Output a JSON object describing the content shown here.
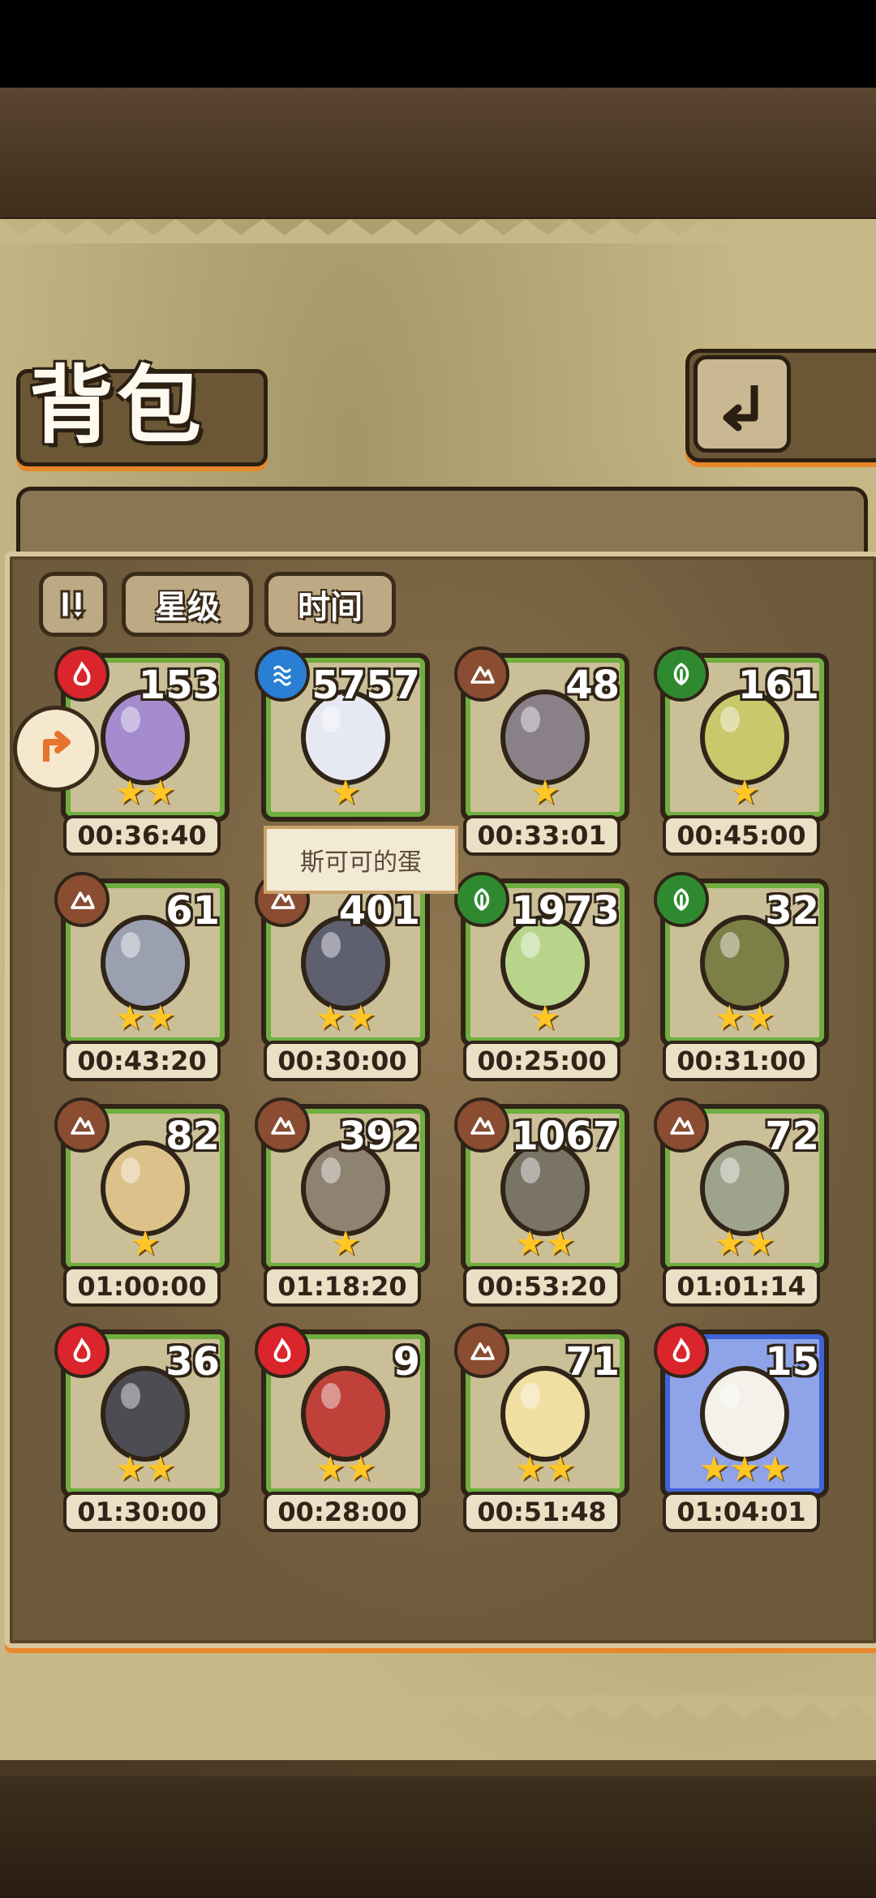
{
  "header": {
    "title": "背包"
  },
  "toolbar": {
    "sort_star_label": "星级",
    "sort_time_label": "时间"
  },
  "tooltip": {
    "text": "斯可可的蛋"
  },
  "colors": {
    "fire": "#d9252b",
    "water": "#2a7fd4",
    "earth": "#8a4d32",
    "grass": "#2f8a2f"
  },
  "items": [
    {
      "count": "153",
      "element": "fire",
      "stars": "★★",
      "timer": "00:36:40",
      "egg_color": "#a48ccf"
    },
    {
      "count": "5757",
      "element": "water",
      "stars": "★",
      "timer": "",
      "egg_color": "#e6e9f2"
    },
    {
      "count": "48",
      "element": "earth",
      "stars": "★",
      "timer": "00:33:01",
      "egg_color": "#8a8088"
    },
    {
      "count": "161",
      "element": "grass",
      "stars": "★",
      "timer": "00:45:00",
      "egg_color": "#c9c86a"
    },
    {
      "count": "61",
      "element": "earth",
      "stars": "★★",
      "timer": "00:43:20",
      "egg_color": "#9aa0b0"
    },
    {
      "count": "401",
      "element": "earth",
      "stars": "★★",
      "timer": "00:30:00",
      "egg_color": "#5e6070"
    },
    {
      "count": "1973",
      "element": "grass",
      "stars": "★",
      "timer": "00:25:00",
      "egg_color": "#b7d48a"
    },
    {
      "count": "32",
      "element": "grass",
      "stars": "★★",
      "timer": "00:31:00",
      "egg_color": "#7c8046"
    },
    {
      "count": "82",
      "element": "earth",
      "stars": "★",
      "timer": "01:00:00",
      "egg_color": "#dcc28a"
    },
    {
      "count": "392",
      "element": "earth",
      "stars": "★",
      "timer": "01:18:20",
      "egg_color": "#8e8270"
    },
    {
      "count": "1067",
      "element": "earth",
      "stars": "★★",
      "timer": "00:53:20",
      "egg_color": "#7a7466"
    },
    {
      "count": "72",
      "element": "earth",
      "stars": "★★",
      "timer": "01:01:14",
      "egg_color": "#9ea48c"
    },
    {
      "count": "36",
      "element": "fire",
      "stars": "★★",
      "timer": "01:30:00",
      "egg_color": "#4c4c52"
    },
    {
      "count": "9",
      "element": "fire",
      "stars": "★★",
      "timer": "00:28:00",
      "egg_color": "#c0413a"
    },
    {
      "count": "71",
      "element": "earth",
      "stars": "★★",
      "timer": "00:51:48",
      "egg_color": "#f0dfa0"
    },
    {
      "count": "15",
      "element": "fire",
      "stars": "★★★",
      "timer": "01:04:01",
      "egg_color": "#f4f0ea"
    }
  ]
}
